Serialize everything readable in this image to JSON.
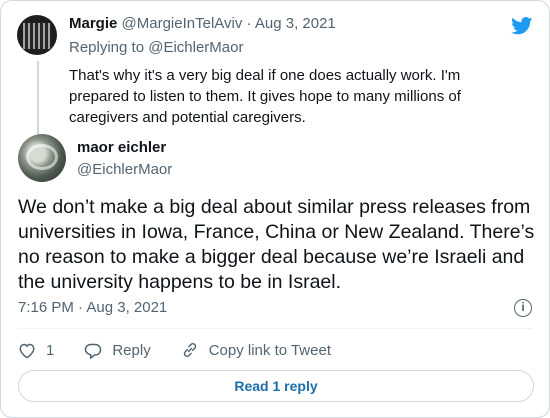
{
  "parent_tweet": {
    "name": "Margie",
    "handle": "@MargieInTelAviv",
    "separator": "·",
    "date": "Aug 3, 2021",
    "replying_to_prefix": "Replying to",
    "replying_to_handle": "@EichlerMaor",
    "text": "That's why it's a very big deal if one does actually work. I'm prepared to listen to them. It gives hope to many millions of caregivers and potential caregivers."
  },
  "main_tweet": {
    "name": "maor eichler",
    "handle": "@EichlerMaor",
    "text": "We don’t make a big deal about similar press releases from universities in Iowa, France, China or New Zealand. There’s no reason to make a bigger deal because we’re Israeli and the university happens to be in Israel.",
    "timestamp": "7:16 PM · Aug 3, 2021",
    "info_icon": "i"
  },
  "actions": {
    "like_count": "1",
    "reply_label": "Reply",
    "copy_link_label": "Copy link to Tweet"
  },
  "read_replies_label": "Read 1 reply",
  "colors": {
    "twitter_blue": "#1d9bf0",
    "link_blue": "#1d6ea8",
    "secondary_text": "#536471"
  },
  "icons": [
    "twitter-bird-icon",
    "heart-icon",
    "reply-bubble-icon",
    "link-icon",
    "info-icon"
  ]
}
